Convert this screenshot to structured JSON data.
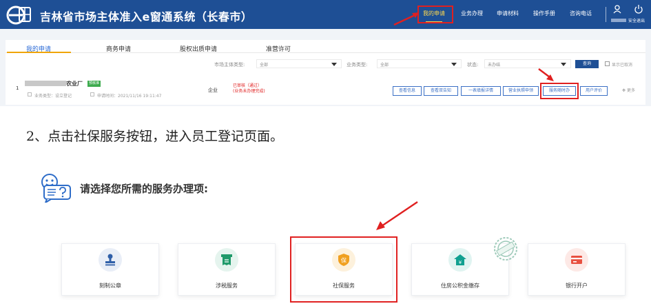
{
  "header": {
    "title": "吉林省市场主体准入e窗通系统（长春市）",
    "nav": [
      "我的申请",
      "业务办理",
      "申请材料",
      "操作手册",
      "咨询电话"
    ],
    "logout": "安全退出"
  },
  "tabs": [
    "我的申请",
    "商务申请",
    "股权出质申请",
    "准营许可"
  ],
  "filters": {
    "entity_type_label": "市场主体类型:",
    "entity_type_value": "全部",
    "business_type_label": "业务类型:",
    "business_type_value": "全部",
    "status_label": "状态:",
    "status_value": "未办结",
    "query_button": "查询",
    "show_cancelled": "显示已取消"
  },
  "row": {
    "index": "1",
    "name": "农业厂",
    "badge": "预核准",
    "business_type": "业务类型：设立登记",
    "apply_time": "申请时间：2021/11/16 19:11:47",
    "entity_type": "企业",
    "status_line1": "已审核（通过）",
    "status_line2": "(业务未办理完成)",
    "actions": [
      "查看信息",
      "查看双告知",
      "一表填报详情",
      "营业执照申领",
      "服务随时办",
      "用户评价"
    ],
    "more": "更多"
  },
  "instruction": "2、点击社保服务按钮，进入员工登记页面。",
  "service_title": "请选择您所需的服务办理项:",
  "services": [
    {
      "label": "刻制公章",
      "icon": "stamp-icon",
      "color": "#2f5fa8"
    },
    {
      "label": "涉税服务",
      "icon": "receipt-icon",
      "color": "#1f9a6a"
    },
    {
      "label": "社保服务",
      "icon": "shield-icon",
      "color": "#f0a020"
    },
    {
      "label": "住房公积金缴存",
      "icon": "house-icon",
      "color": "#10a090"
    },
    {
      "label": "银行开户",
      "icon": "card-icon",
      "color": "#e85040"
    }
  ]
}
